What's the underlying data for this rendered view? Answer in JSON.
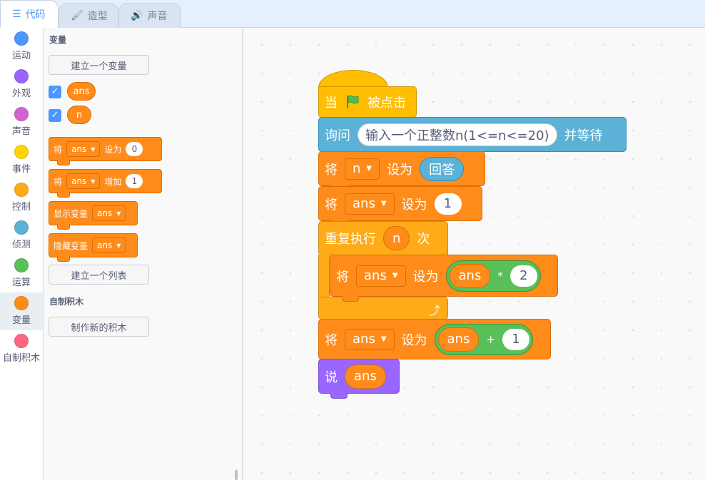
{
  "tabs": [
    {
      "label": "代码",
      "icon": "code-icon",
      "active": true
    },
    {
      "label": "造型",
      "icon": "brush-icon",
      "active": false
    },
    {
      "label": "声音",
      "icon": "speaker-icon",
      "active": false
    }
  ],
  "categories": [
    {
      "label": "运动",
      "color": "#4c97ff"
    },
    {
      "label": "外观",
      "color": "#9966ff"
    },
    {
      "label": "声音",
      "color": "#cf63cf"
    },
    {
      "label": "事件",
      "color": "#ffd500"
    },
    {
      "label": "控制",
      "color": "#ffab19"
    },
    {
      "label": "侦测",
      "color": "#5cb1d6"
    },
    {
      "label": "运算",
      "color": "#59c059"
    },
    {
      "label": "变量",
      "color": "#ff8c1a",
      "selected": true
    },
    {
      "label": "自制积木",
      "color": "#ff6680"
    }
  ],
  "palette": {
    "variables_title": "变量",
    "make_variable_button": "建立一个变量",
    "variables": [
      "ans",
      "n"
    ],
    "set_block": {
      "word": "将",
      "var": "ans",
      "op": "设为",
      "value": "0"
    },
    "change_block": {
      "word": "将",
      "var": "ans",
      "op": "增加",
      "value": "1"
    },
    "show_block": {
      "label": "显示变量",
      "var": "ans"
    },
    "hide_block": {
      "label": "隐藏变量",
      "var": "ans"
    },
    "make_list_button": "建立一个列表",
    "myblocks_title": "自制积木",
    "make_block_button": "制作新的积木"
  },
  "script": {
    "hat": {
      "before": "当",
      "after": "被点击"
    },
    "ask": {
      "label": "询问",
      "question": "输入一个正整数n(1<=n<=20)",
      "suffix": "并等待"
    },
    "set_n": {
      "word": "将",
      "var": "n",
      "op": "设为",
      "reporter": "回答"
    },
    "set_ans": {
      "word": "将",
      "var": "ans",
      "op": "设为",
      "value": "1"
    },
    "repeat": {
      "label": "重复执行",
      "times_var": "n",
      "suffix": "次"
    },
    "inner_set": {
      "word": "将",
      "var": "ans",
      "op": "设为",
      "left": "ans",
      "operator": "*",
      "right": "2"
    },
    "set_plus": {
      "word": "将",
      "var": "ans",
      "op": "设为",
      "left": "ans",
      "operator": "+",
      "right": "1"
    },
    "say": {
      "word": "说",
      "var": "ans"
    }
  }
}
